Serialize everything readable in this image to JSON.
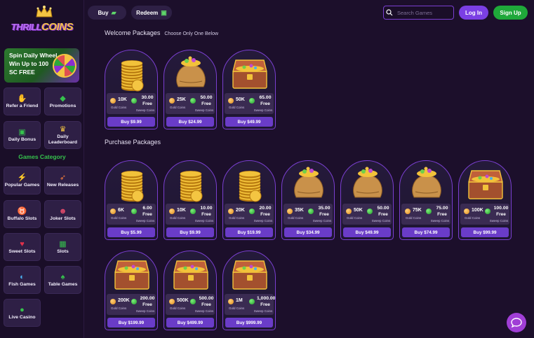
{
  "brand": {
    "logo_word_1": "THRILL",
    "logo_word_2": "COINS"
  },
  "promo": {
    "spin_text": "Spin Daily Wheel Win Up to 100 SC FREE"
  },
  "nav": {
    "items": [
      {
        "label": "Refer a Friend",
        "icon": "handshake-icon"
      },
      {
        "label": "Promotions",
        "icon": "ticket-icon"
      },
      {
        "label": "Daily Bonus",
        "icon": "gift-icon"
      },
      {
        "label": "Daily Leaderboard",
        "icon": "trophy-icon"
      }
    ],
    "category_title": "Games Category",
    "categories": [
      {
        "label": "Popular Games",
        "icon": "lightning-icon"
      },
      {
        "label": "New Releases",
        "icon": "rocket-icon"
      },
      {
        "label": "Buffalo Slots",
        "icon": "buffalo-icon"
      },
      {
        "label": "Joker Slots",
        "icon": "joker-icon"
      },
      {
        "label": "Sweet Slots",
        "icon": "cherry-icon"
      },
      {
        "label": "Slots",
        "icon": "slot-machine-icon"
      },
      {
        "label": "Fish Games",
        "icon": "fish-icon"
      },
      {
        "label": "Table Games",
        "icon": "cards-icon"
      },
      {
        "label": "Live Casino",
        "icon": "chip-icon"
      }
    ]
  },
  "topbar": {
    "buy_label": "Buy",
    "redeem_label": "Redeem",
    "search_placeholder": "Search Games",
    "login_label": "Log In",
    "signup_label": "Sign Up"
  },
  "welcome": {
    "title": "Welcome Packages",
    "subtitle": "Choose Only One Below",
    "packages": [
      {
        "art": "coin-stack",
        "gc": "10K",
        "sc": "30.00",
        "buy": "Buy $9.99"
      },
      {
        "art": "coin-bag",
        "gc": "25K",
        "sc": "50.00",
        "buy": "Buy $24.99"
      },
      {
        "art": "treasure-chest",
        "gc": "50K",
        "sc": "65.00",
        "buy": "Buy $49.99"
      }
    ]
  },
  "purchase": {
    "title": "Purchase Packages",
    "packages": [
      {
        "art": "coin-stack",
        "gc": "6K",
        "sc": "6.00",
        "buy": "Buy $5.99"
      },
      {
        "art": "coin-stack",
        "gc": "10K",
        "sc": "10.00",
        "buy": "Buy $9.99"
      },
      {
        "art": "coin-stack",
        "gc": "20K",
        "sc": "20.00",
        "buy": "Buy $19.99"
      },
      {
        "art": "coin-bag",
        "gc": "35K",
        "sc": "35.00",
        "buy": "Buy $34.99"
      },
      {
        "art": "coin-bag",
        "gc": "50K",
        "sc": "50.00",
        "buy": "Buy $49.99"
      },
      {
        "art": "coin-bag",
        "gc": "75K",
        "sc": "75.00",
        "buy": "Buy $74.99"
      },
      {
        "art": "treasure-chest",
        "gc": "100K",
        "sc": "100.00",
        "buy": "Buy $99.99"
      },
      {
        "art": "treasure-chest",
        "gc": "200K",
        "sc": "200.00",
        "buy": "Buy $199.99"
      },
      {
        "art": "treasure-chest",
        "gc": "500K",
        "sc": "500.00",
        "buy": "Buy $499.99"
      },
      {
        "art": "treasure-chest",
        "gc": "1M",
        "sc": "1,000.00",
        "buy": "Buy $999.99"
      }
    ]
  },
  "labels": {
    "gold_coins": "Gold Coins",
    "free": "Free",
    "sweep_coins": "Sweep Coins"
  },
  "colors": {
    "background": "#1c0f2b",
    "accent_purple": "#7b3fe4",
    "accent_green": "#1fa83a",
    "gold": "#f4c542"
  }
}
